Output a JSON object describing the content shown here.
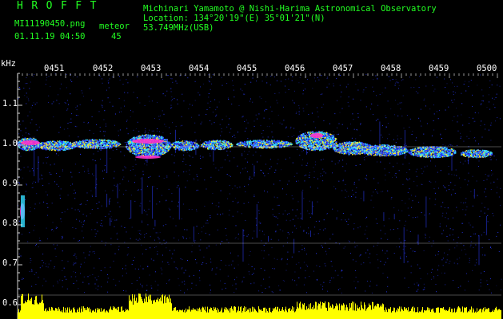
{
  "header": {
    "logo": "HROFFT",
    "filename": "MI11190450.png",
    "datetime": "01.11.19 04:50",
    "meteor_label": "meteor",
    "meteor_count": "45",
    "observer": "Michinari Yamamoto @ Nishi-Harima Astronomical Observatory",
    "location": "Location: 134°20'19\"(E) 35°01'21\"(N)",
    "frequency": "53.749MHz(USB)"
  },
  "axis": {
    "y_unit": "kHz",
    "y_ticks": [
      "1.1",
      "1.0",
      "0.9",
      "0.8",
      "0.7",
      "0.6"
    ],
    "x_ticks": [
      "0451",
      "0452",
      "0453",
      "0454",
      "0455",
      "0456",
      "0457",
      "0458",
      "0459",
      "0500"
    ]
  },
  "colors": {
    "background": "#000000",
    "grid": "#ffffff",
    "header_green": "#22ff22",
    "noise_blue": "#2a3cff",
    "signal_cyan": "#33ddff",
    "signal_yellow": "#ffee22",
    "signal_magenta": "#ff33cc",
    "level_cyan": "#00e5ff",
    "level_yellow": "#ffff00"
  }
}
